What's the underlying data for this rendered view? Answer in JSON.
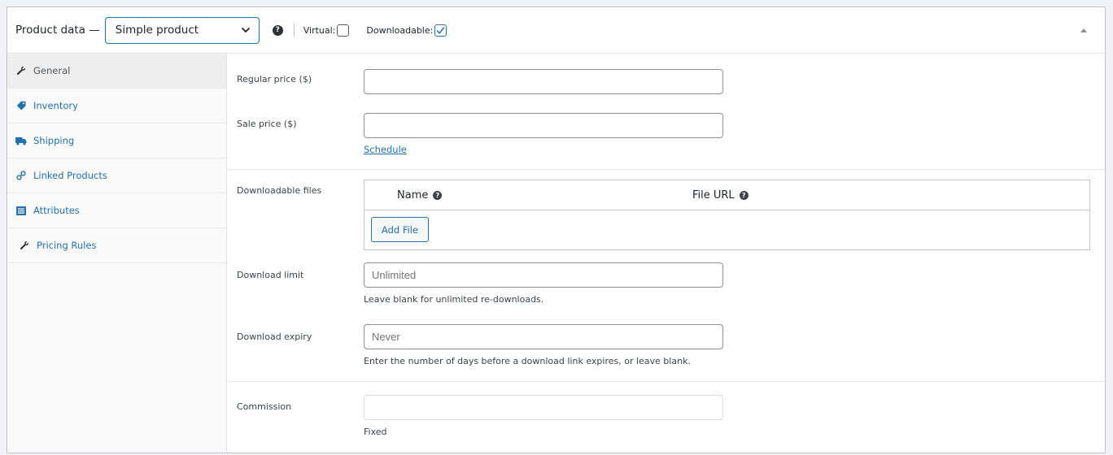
{
  "header": {
    "title": "Product data —",
    "product_type": "Simple product",
    "virtual_label": "Virtual:",
    "virtual_checked": false,
    "downloadable_label": "Downloadable:",
    "downloadable_checked": true
  },
  "tabs": [
    {
      "label": "General",
      "icon": "wrench-icon",
      "active": true
    },
    {
      "label": "Inventory",
      "icon": "tag-icon",
      "active": false
    },
    {
      "label": "Shipping",
      "icon": "truck-icon",
      "active": false
    },
    {
      "label": "Linked Products",
      "icon": "link-icon",
      "active": false
    },
    {
      "label": "Attributes",
      "icon": "list-icon",
      "active": false
    },
    {
      "label": "Pricing Rules",
      "icon": "wrench-icon",
      "active": false
    }
  ],
  "pricing": {
    "regular_label": "Regular price ($)",
    "regular_value": "",
    "sale_label": "Sale price ($)",
    "sale_value": "",
    "schedule_link": "Schedule"
  },
  "downloads": {
    "files_label": "Downloadable files",
    "col_name": "Name",
    "col_url": "File URL",
    "add_file_button": "Add File",
    "limit_label": "Download limit",
    "limit_placeholder": "Unlimited",
    "limit_desc": "Leave blank for unlimited re-downloads.",
    "expiry_label": "Download expiry",
    "expiry_placeholder": "Never",
    "expiry_desc": "Enter the number of days before a download link expires, or leave blank."
  },
  "commission": {
    "label": "Commission",
    "value": "",
    "desc": "Fixed"
  },
  "colors": {
    "accent": "#2271b1",
    "background": "#f0f2f7",
    "tab_active_bg": "#eeeeee"
  }
}
